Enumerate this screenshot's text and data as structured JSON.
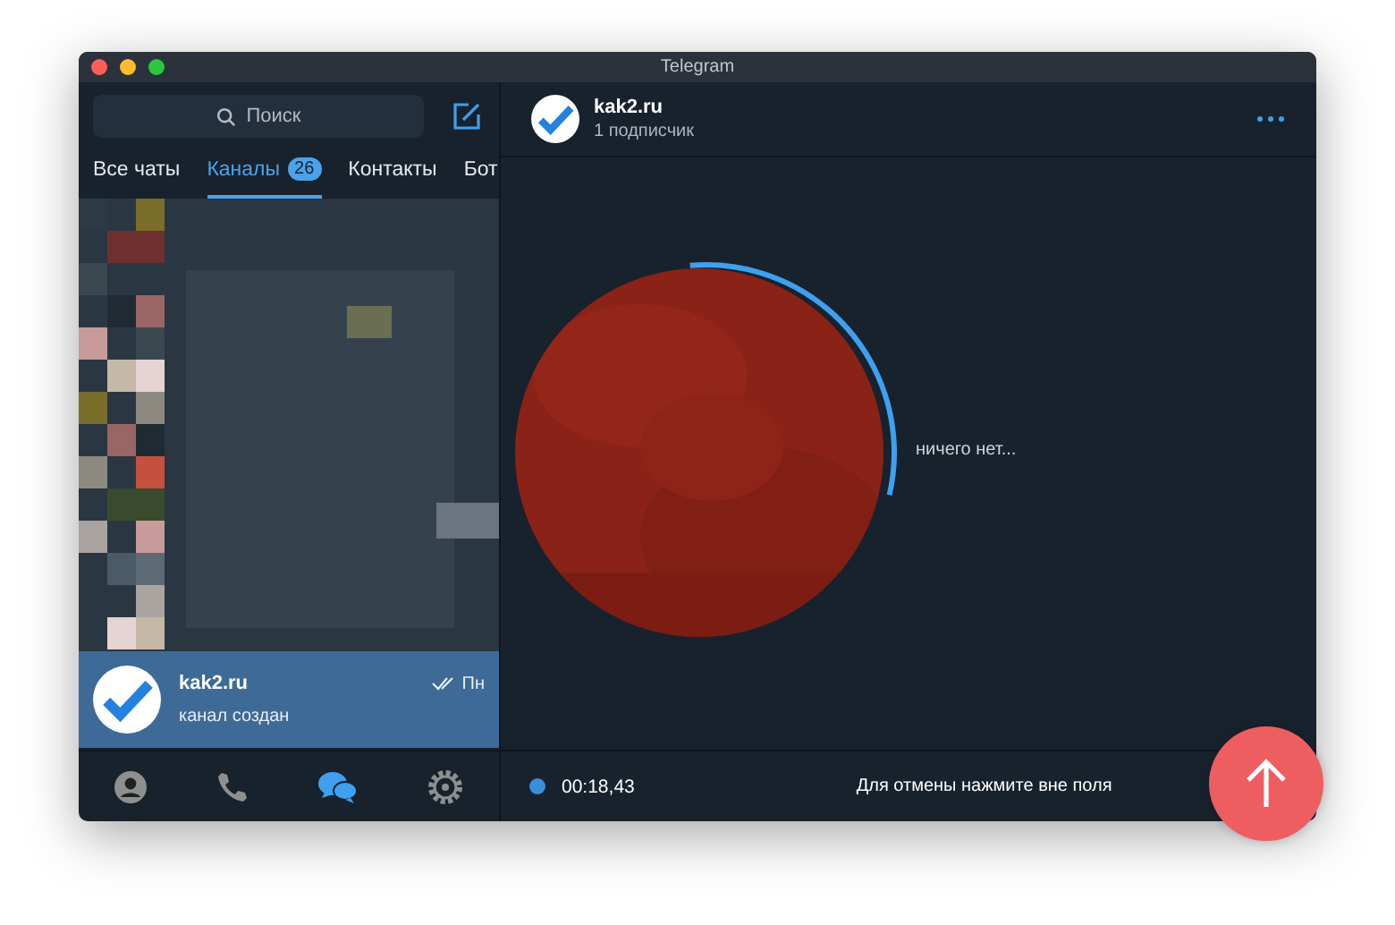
{
  "window": {
    "title": "Telegram"
  },
  "search": {
    "placeholder": "Поиск"
  },
  "tabs": [
    {
      "label": "Все чаты",
      "selected": false
    },
    {
      "label": "Каналы",
      "selected": true,
      "badge": "26"
    },
    {
      "label": "Контакты",
      "selected": false
    },
    {
      "label": "Бот",
      "selected": false
    }
  ],
  "chats": [
    {
      "name": "kak2.ru",
      "preview": "канал создан",
      "time": "Пн",
      "selected": true
    }
  ],
  "bottom_nav": [
    {
      "kind": "contacts",
      "selected": false
    },
    {
      "kind": "calls",
      "selected": false
    },
    {
      "kind": "chats",
      "selected": true
    },
    {
      "kind": "settings",
      "selected": false
    }
  ],
  "channel": {
    "name": "kak2.ru",
    "subscribers": "1 подписчик"
  },
  "empty_text": "ничего нет...",
  "recording": {
    "time": "00:18,43",
    "hint": "Для отмены нажмите вне поля"
  }
}
